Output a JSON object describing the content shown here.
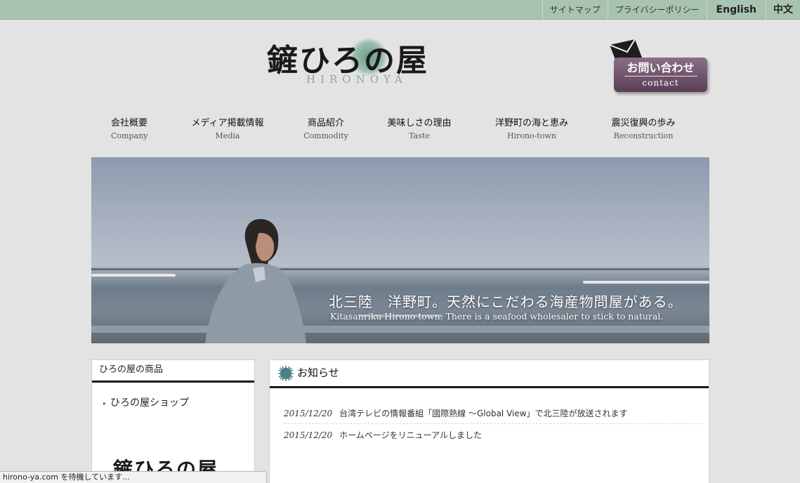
{
  "topbar": {
    "sitemap": "サイトマップ",
    "privacy": "プライバシーポリシー",
    "english": "English",
    "chinese": "中文",
    "bg_color": "#a9c3b1"
  },
  "logo": {
    "brush_text": "鏟ひろの屋",
    "roman": "HIRONOYA"
  },
  "contact": {
    "ja": "お問い合わせ",
    "en": "contact",
    "icon": "envelope-icon"
  },
  "nav": {
    "items": [
      {
        "ja": "会社概要",
        "en": "Company"
      },
      {
        "ja": "メディア掲載情報",
        "en": "Media"
      },
      {
        "ja": "商品紹介",
        "en": "Commodity"
      },
      {
        "ja": "美味しさの理由",
        "en": "Taste"
      },
      {
        "ja": "洋野町の海と恵み",
        "en": "Hirono-town"
      },
      {
        "ja": "震災復興の歩み",
        "en": "Reconstruction"
      }
    ]
  },
  "hero": {
    "catch_ja": "北三陸　洋野町。天然にこだわる海産物問屋がある。",
    "catch_en": "Kitasanriku Hirono town. There is a seafood wholesaler to stick to natural."
  },
  "products": {
    "title": "ひろの屋の商品",
    "shop_link": "ひろの屋ショップ",
    "mini_logo": "鏟ひろの屋"
  },
  "news": {
    "title": "お知らせ",
    "items": [
      {
        "date": "2015/12/20",
        "text": "台湾テレビの情報番組「國際熱線 〜Global View」で北三陸が放送されます"
      },
      {
        "date": "2015/12/20",
        "text": "ホームページをリニューアルしました"
      }
    ]
  },
  "status_bar": {
    "text": "hirono-ya.com を待機しています..."
  }
}
